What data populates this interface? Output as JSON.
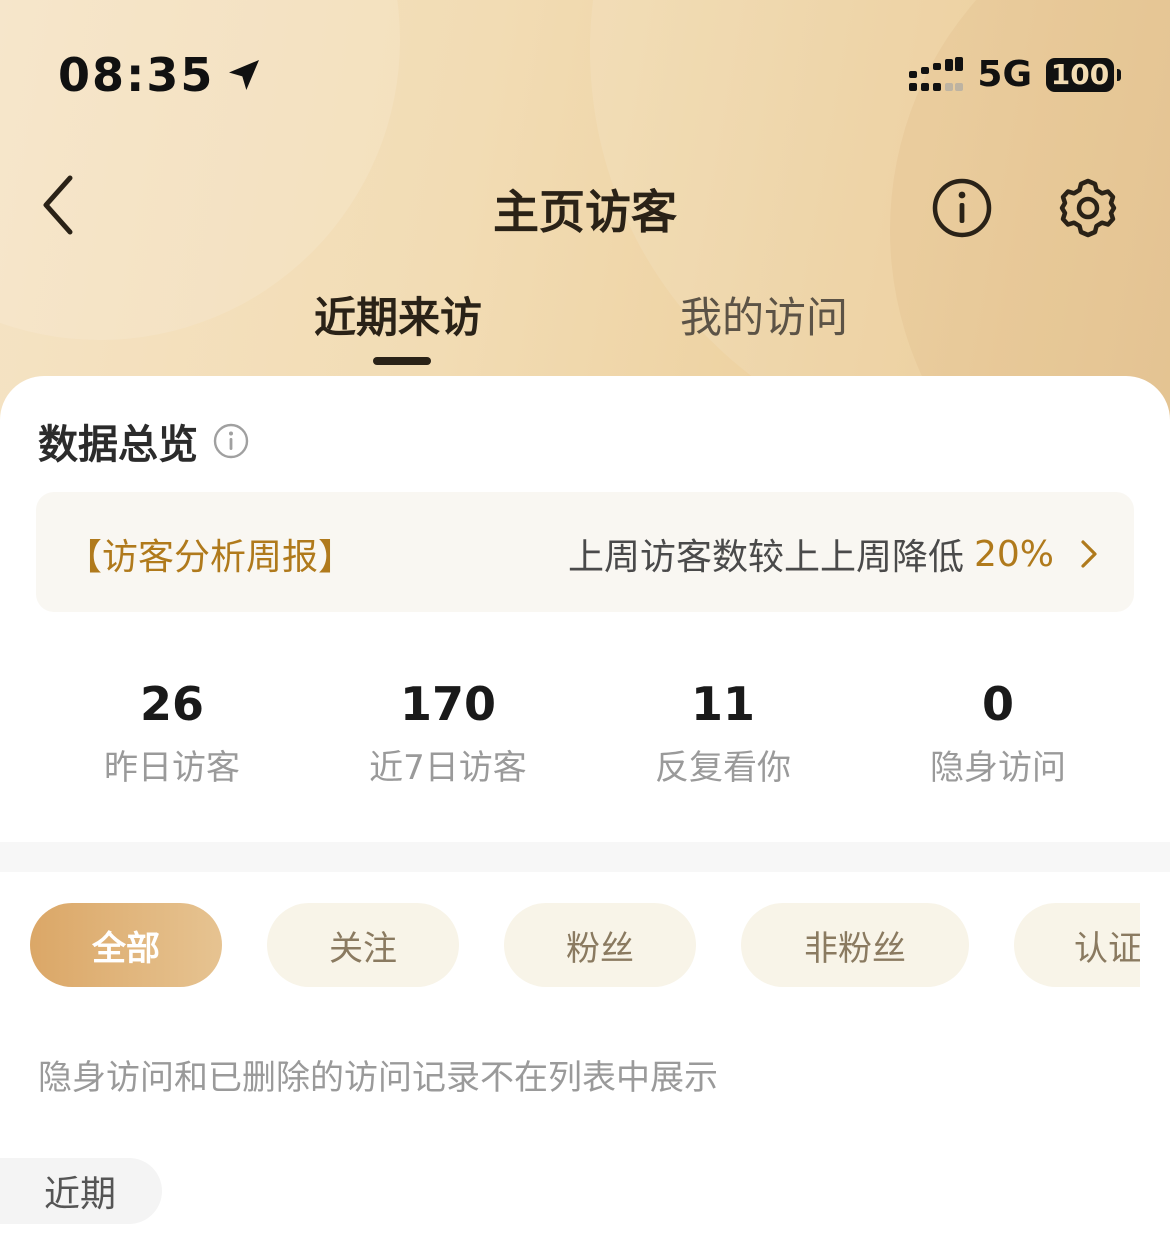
{
  "status_bar": {
    "time": "08:35",
    "network": "5G",
    "battery": "100"
  },
  "nav": {
    "title": "主页访客"
  },
  "tabs": [
    {
      "label": "近期来访",
      "active": true
    },
    {
      "label": "我的访问",
      "active": false
    }
  ],
  "overview": {
    "title": "数据总览",
    "report": {
      "tag": "【访客分析周报】",
      "text": "上周访客数较上上周降低",
      "percent": "20%"
    },
    "stats": [
      {
        "value": "26",
        "label": "昨日访客"
      },
      {
        "value": "170",
        "label": "近7日访客"
      },
      {
        "value": "11",
        "label": "反复看你"
      },
      {
        "value": "0",
        "label": "隐身访问"
      }
    ]
  },
  "filters": {
    "chips": [
      {
        "label": "全部",
        "active": true
      },
      {
        "label": "关注",
        "active": false
      },
      {
        "label": "粉丝",
        "active": false
      },
      {
        "label": "非粉丝",
        "active": false
      },
      {
        "label": "认证",
        "active": false
      }
    ]
  },
  "notice": "隐身访问和已删除的访问记录不在列表中展示",
  "list": {
    "group_label": "近期"
  },
  "colors": {
    "accent": "#b07a1c",
    "header_gold": "#f2dcb4",
    "chip_active": "#dba767",
    "chip_bg": "#f8f4e8"
  }
}
